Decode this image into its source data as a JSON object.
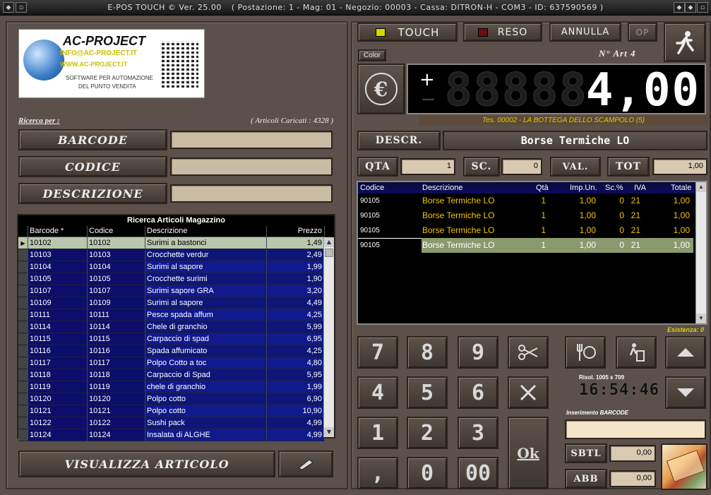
{
  "titlebar": {
    "app": "E-POS  TOUCH © Ver. 25.00",
    "info": "( Postazione: 1 - Mag: 01 - Negozio: 00003 - Cassa: DITRON-H - COM3 - ID: 637590569 )"
  },
  "logo": {
    "brand": "AC-PROJECT",
    "url1": "INFO@AC-PROJECT.IT",
    "url2": "WWW.AC-PROJECT.IT",
    "tagline1": "SOFTWARE PER AUTOMAZIONE",
    "tagline2": "DEL PUNTO VENDITA"
  },
  "search": {
    "label": "Ricerca per :",
    "loaded": "( Articoli Caricati : 4328 )",
    "barcode_label": "Barcode",
    "codice_label": "Codice",
    "descrizione_label": "Descrizione"
  },
  "grid": {
    "title": "Ricerca Articoli Magazzino",
    "columns": [
      "Barcode  *",
      "Codice",
      "Descrizione",
      "Prezzo"
    ],
    "rows": [
      [
        "10102",
        "10102",
        "Surimi a bastonci",
        "1,49"
      ],
      [
        "10103",
        "10103",
        "Crocchette verdur",
        "2,49"
      ],
      [
        "10104",
        "10104",
        "Surimi al sapore",
        "1,99"
      ],
      [
        "10105",
        "10105",
        "Crocchette surimi",
        "1,90"
      ],
      [
        "10107",
        "10107",
        "Surimi sapore GRA",
        "3,20"
      ],
      [
        "10109",
        "10109",
        "Surimi al sapore",
        "4,49"
      ],
      [
        "10111",
        "10111",
        "Pesce spada affum",
        "4,25"
      ],
      [
        "10114",
        "10114",
        "Chele di granchio",
        "5,99"
      ],
      [
        "10115",
        "10115",
        "Carpaccio di spad",
        "6,95"
      ],
      [
        "10116",
        "10116",
        "Spada affumicato",
        "4,25"
      ],
      [
        "10117",
        "10117",
        "Polpo Cotto a toc",
        "4,80"
      ],
      [
        "10118",
        "10118",
        "Carpaccio di Spad",
        "5,95"
      ],
      [
        "10119",
        "10119",
        "chele di granchio",
        "1,99"
      ],
      [
        "10120",
        "10120",
        "Polpo cotto",
        "6,90"
      ],
      [
        "10121",
        "10121",
        "Polpo cotto",
        "10,90"
      ],
      [
        "10122",
        "10122",
        "Sushi pack",
        "4,99"
      ],
      [
        "10124",
        "10124",
        "Insalata di ALGHE",
        "4,99"
      ]
    ]
  },
  "visualizza_label": "Visualizza Articolo",
  "top_buttons": {
    "touch": "Touch",
    "reso": "Reso",
    "annulla": "Annulla",
    "op": "Op"
  },
  "color_label": "Color",
  "art_label": "N° Art 4",
  "display": {
    "plus": "+",
    "minus": "−",
    "ghost": "88888",
    "value": "4,00"
  },
  "tes_bar": "Tes. 00002 - LA BOTTEGA DELLO SCAMPOLO (5)",
  "descr": {
    "label": "Descr.",
    "value": "Borse Termiche LO"
  },
  "qty_row": {
    "qta_label": "Qta",
    "qta_value": "1",
    "sc_label": "Sc.",
    "sc_value": "0",
    "val_label": "Val.",
    "tot_label": "Tot",
    "tot_value": "1,00"
  },
  "receipt": {
    "columns": [
      "Codice",
      "Descrizione",
      "Qtà",
      "Imp.Un.",
      "Sc.%",
      "IVA",
      "Totale"
    ],
    "rows": [
      [
        "90105",
        "Borse Termiche LO",
        "1",
        "1,00",
        "0",
        "21",
        "1,00"
      ],
      [
        "90105",
        "Borse Termiche LO",
        "1",
        "1,00",
        "0",
        "21",
        "1,00"
      ],
      [
        "90105",
        "Borse Termiche LO",
        "1",
        "1,00",
        "0",
        "21",
        "1,00"
      ],
      [
        "90105",
        "Borse Termiche LO",
        "1",
        "1,00",
        "0",
        "21",
        "1,00"
      ]
    ]
  },
  "esistenza": "Esistenza: 0",
  "keypad": {
    "k7": "7",
    "k8": "8",
    "k9": "9",
    "k4": "4",
    "k5": "5",
    "k6": "6",
    "k1": "1",
    "k2": "2",
    "k3": "3",
    "comma": ",",
    "k0": "0",
    "k00": "00",
    "ok": "Ok"
  },
  "risol": "Risol. 1005 x 709",
  "clock": "16:54:46",
  "inserimento_label": "Inserimento  BARCODE",
  "sbtl_label": "Sbtl",
  "sbtl_value": "0,00",
  "abb_label": "Abb",
  "abb_value": "0,00",
  "colors": {
    "background": "#5b514a",
    "grid_blue": "#101a8c",
    "receipt_yellow": "#f2c400",
    "tes_yellow": "#e0c800"
  }
}
